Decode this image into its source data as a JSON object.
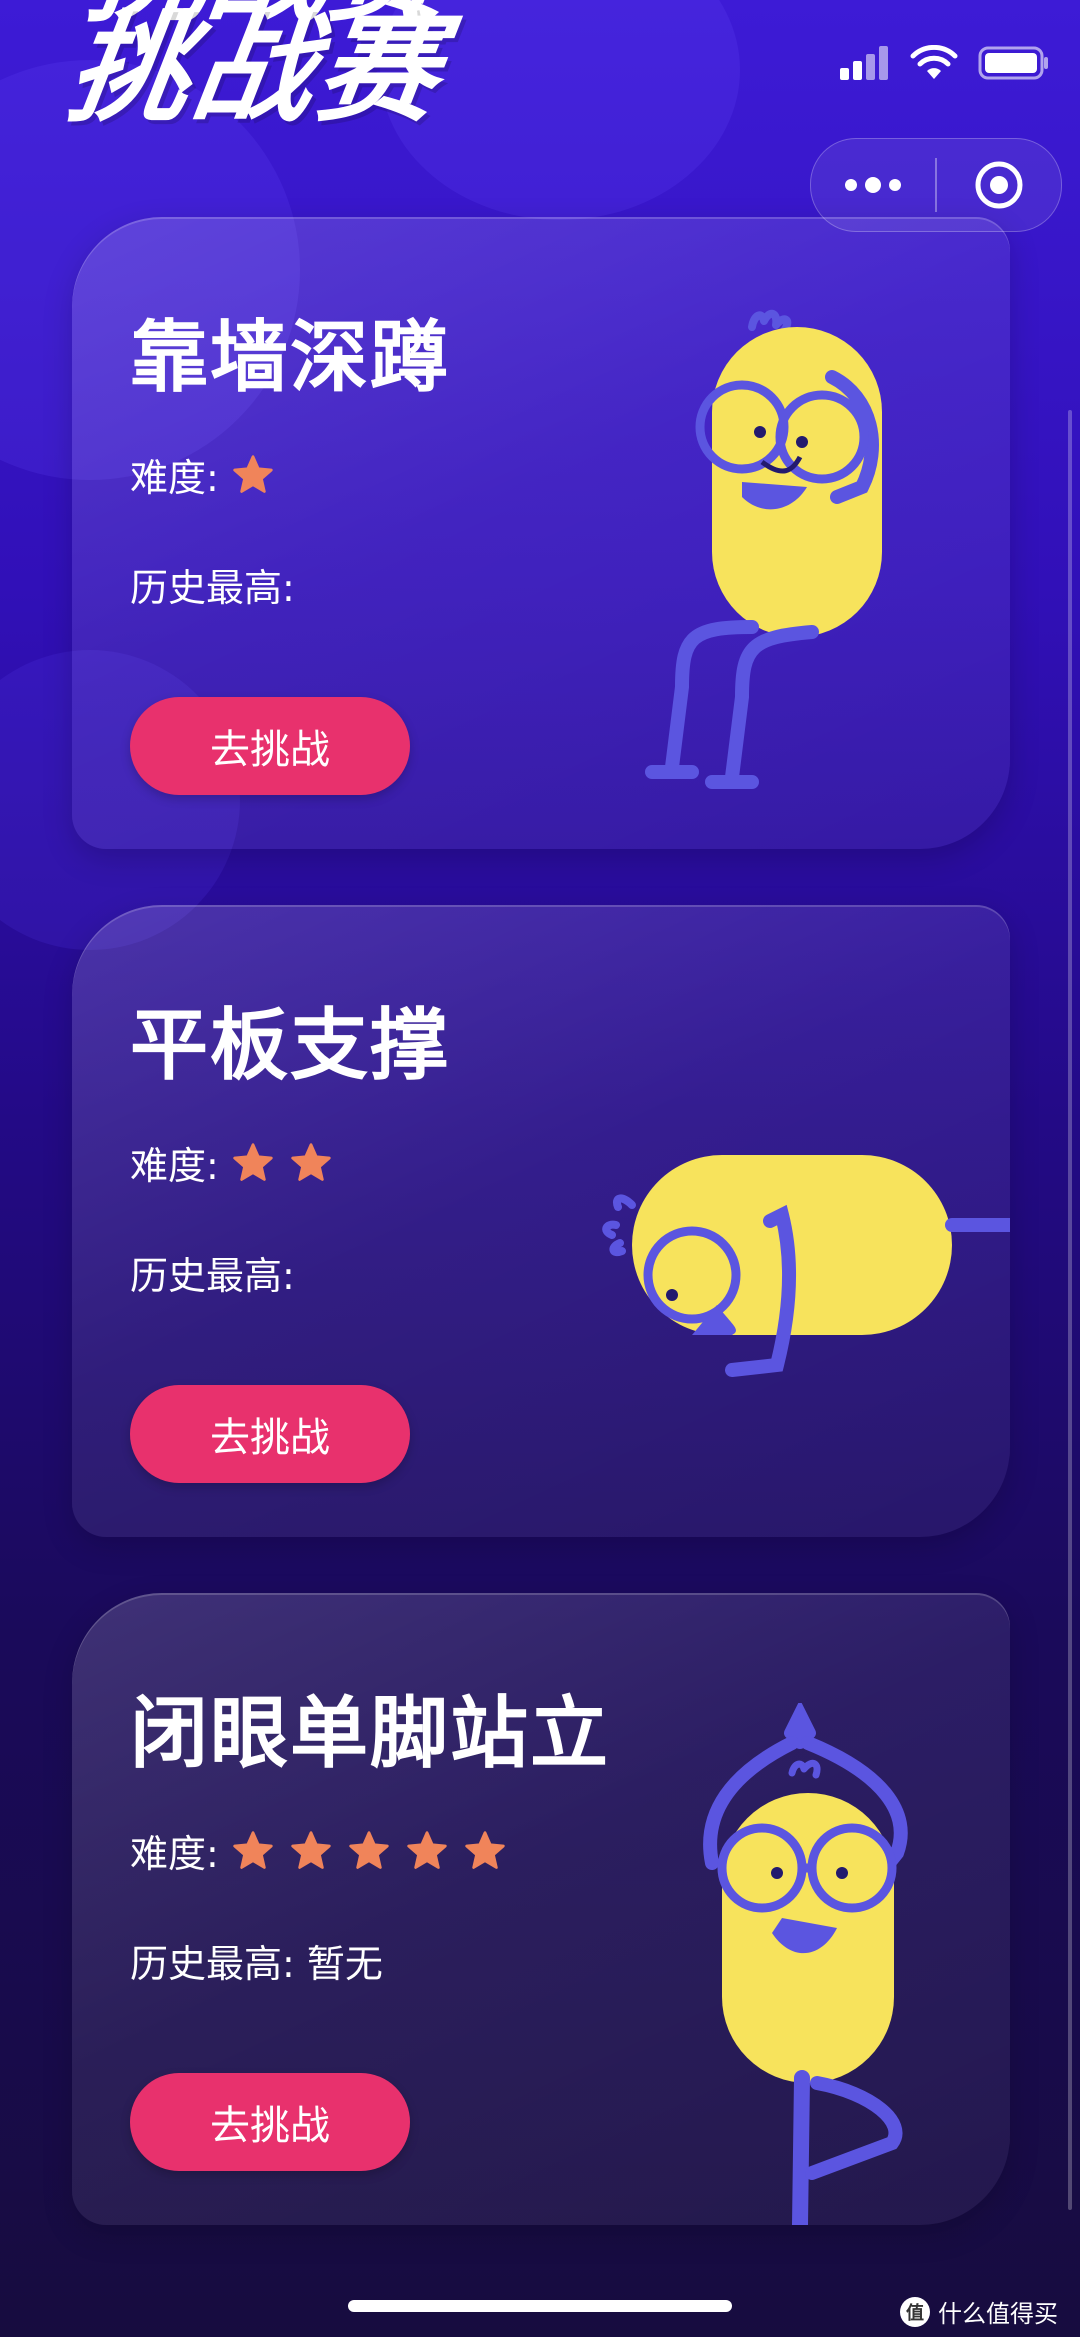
{
  "header": {
    "title": "挑战赛"
  },
  "capsule": {
    "menu_icon": "more-dots-icon",
    "close_icon": "target-circle-icon"
  },
  "cards": [
    {
      "title": "靠墙深蹲",
      "difficulty_label": "难度:",
      "difficulty_stars": 1,
      "best_label": "历史最高:",
      "best_value": "",
      "button_label": "去挑战"
    },
    {
      "title": "平板支撑",
      "difficulty_label": "难度:",
      "difficulty_stars": 2,
      "best_label": "历史最高:",
      "best_value": "",
      "button_label": "去挑战"
    },
    {
      "title": "闭眼单脚站立",
      "difficulty_label": "难度:",
      "difficulty_stars": 5,
      "best_label": "历史最高:",
      "best_value": "暂无",
      "button_label": "去挑战"
    }
  ],
  "watermark": {
    "text": "什么值得买",
    "badge": "值"
  },
  "colors": {
    "accent": "#e8316d",
    "star": "#f0845a",
    "figure_yellow": "#f7e35c",
    "figure_limb": "#5b55e0"
  }
}
